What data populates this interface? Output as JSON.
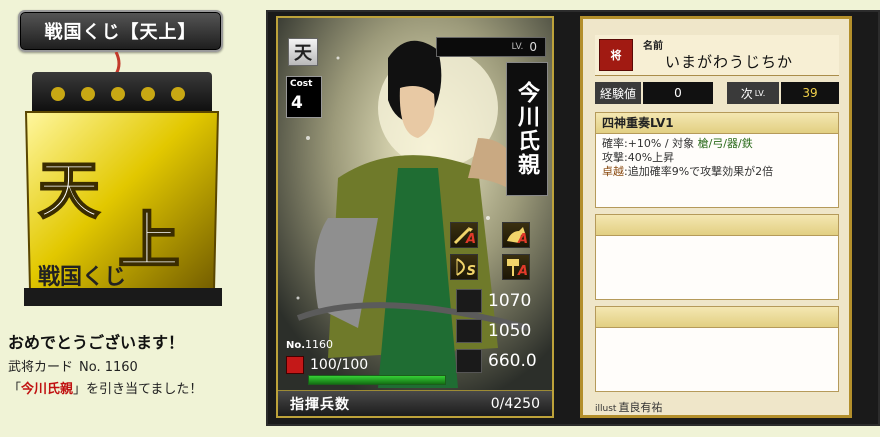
{
  "left": {
    "title_plate": "戦国くじ【天上】",
    "congrats": "おめでとうございます！",
    "card_no_label": "武将カード",
    "card_no_value": "No. 1160",
    "drawn_prefix": "「",
    "drawn_name": "今川氏親",
    "drawn_suffix": "」を引き当てました！"
  },
  "card": {
    "rarity": "天",
    "level_label": "LV.",
    "level": "0",
    "cost_label": "Cost",
    "cost": "4",
    "name": "今川氏親",
    "skill_grades": [
      "A",
      "A",
      "S",
      "A"
    ],
    "stats": {
      "attack": "1070",
      "defense": "1050",
      "military": "660.0"
    },
    "no_prefix": "No.",
    "no_value": "1160",
    "hp": "100/100",
    "hp_fraction": 1.0,
    "troops_label": "指揮兵数",
    "troops_value": "0/4250"
  },
  "info": {
    "seal_text": "将",
    "name_caption": "名前",
    "name_reading": "いまがわうじちか",
    "exp_label": "経験値",
    "exp_value": "0",
    "next_label": "次",
    "next_unit": "LV.",
    "next_value": "39",
    "skill_name": "四神重奏LV1",
    "skill_line1_pre": "確率:+10%  /  対象 ",
    "skill_line1_targets": "槍/弓/器/鉄",
    "skill_line2": "攻撃:40%上昇",
    "skill_line3_label": "卓越",
    "skill_line3_text": ":追加確率9%で攻撃効果が2倍",
    "illust_label": "illust",
    "illustrator": "直良有祐"
  }
}
